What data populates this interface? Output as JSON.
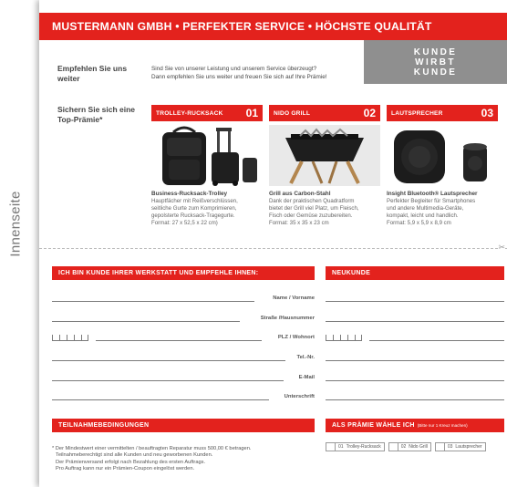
{
  "side_label": "Innenseite",
  "header": {
    "title": "MUSTERMANN GMBH • PERFEKTER SERVICE • HÖCHSTE QUALITÄT"
  },
  "badge": {
    "line1": "KUNDE",
    "line2": "WIRBT",
    "line3": "KUNDE"
  },
  "intro": {
    "heading": "Empfehlen Sie uns weiter",
    "text_line1": "Sind Sie von unserer Leistung und unserem Service überzeugt?",
    "text_line2": "Dann empfehlen Sie uns weiter und freuen Sie sich auf Ihre Prämie!"
  },
  "sichern": "Sichern Sie sich eine Top-Prämie*",
  "prizes": [
    {
      "title": "TROLLEY-RUCKSACK",
      "number": "01",
      "name": "Business-Rucksack-Trolley",
      "desc": [
        "Hauptfächer mit Reißverschlüssen,",
        "seitliche Gurte zum Komprimieren,",
        "gepolsterte Rucksack-Tragegurte.",
        "Format: 27 x 52,5 x 22 cm)"
      ]
    },
    {
      "title": "NIDO GRILL",
      "number": "02",
      "name": "Grill aus Carbon-Stahl",
      "desc": [
        "Dank der praktischen Quadratform",
        "bietet der Grill viel Platz, um Fleisch,",
        "Fisch oder Gemüse zuzubereiten.",
        "Format: 35 x 35 x 23 cm"
      ]
    },
    {
      "title": "LAUTSPRECHER",
      "number": "03",
      "name": "Insight Bluetooth® Lautsprecher",
      "desc": [
        "Perfekter Begleiter für Smartphones",
        "und andere Multimedia-Geräte,",
        "kompakt, leicht und handlich.",
        "Format: 5,9 x 5,9 x 8,9 cm"
      ]
    }
  ],
  "form": {
    "left_title": "ICH BIN KUNDE IHRER WERKSTATT UND EMPFEHLE IHNEN:",
    "right_title": "NEUKUNDE",
    "fields": [
      "Name / Vorname",
      "Straße /Hausnummer",
      "PLZ / Wohnort",
      "Tel.-Nr.",
      "E-Mail",
      "Unterschrift"
    ]
  },
  "conditions": {
    "title": "TEILNAHMEBEDINGUNGEN",
    "lines": [
      "* Der Mindestwert einer vermittelten / beauftragten Reparatur muss 500,00 € betragen.",
      "Teilnahmeberechtigt sind alle Kunden und neu geworbenen Kunden.",
      "Der Prämienversand erfolgt nach Bezahlung des ersten Auftrags.",
      "Pro Auftrag kann nur ein Prämien-Coupon eingelöst werden."
    ]
  },
  "praemie": {
    "title": "ALS PRÄMIE WÄHLE ICH",
    "hint": "(Bitte nur 1 Kreuz machen)",
    "options": [
      {
        "num": "01",
        "label": "Trolley-Rucksack"
      },
      {
        "num": "02",
        "label": "Nido Grill"
      },
      {
        "num": "03",
        "label": "Lautsprecher"
      }
    ]
  },
  "colors": {
    "accent": "#e3221d",
    "badge": "#8f8f8f"
  }
}
